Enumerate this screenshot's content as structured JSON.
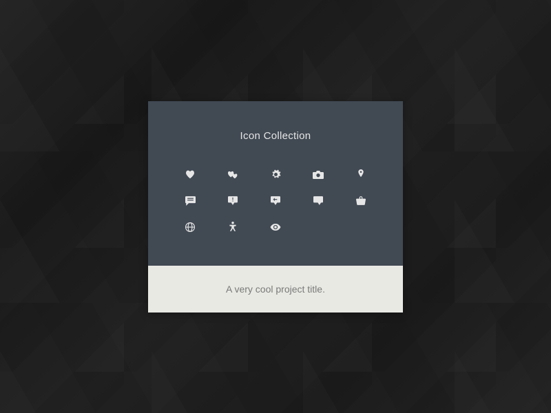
{
  "card": {
    "title": "Icon Collection",
    "project_title": "A very cool project title."
  },
  "icons": [
    "heart-icon",
    "hearts-icon",
    "gear-icon",
    "camera-icon",
    "pin-icon",
    "chat-lines-icon",
    "chat-alert-icon",
    "chat-reply-icon",
    "comment-icon",
    "basket-icon",
    "globe-icon",
    "accessibility-icon",
    "eye-icon"
  ]
}
